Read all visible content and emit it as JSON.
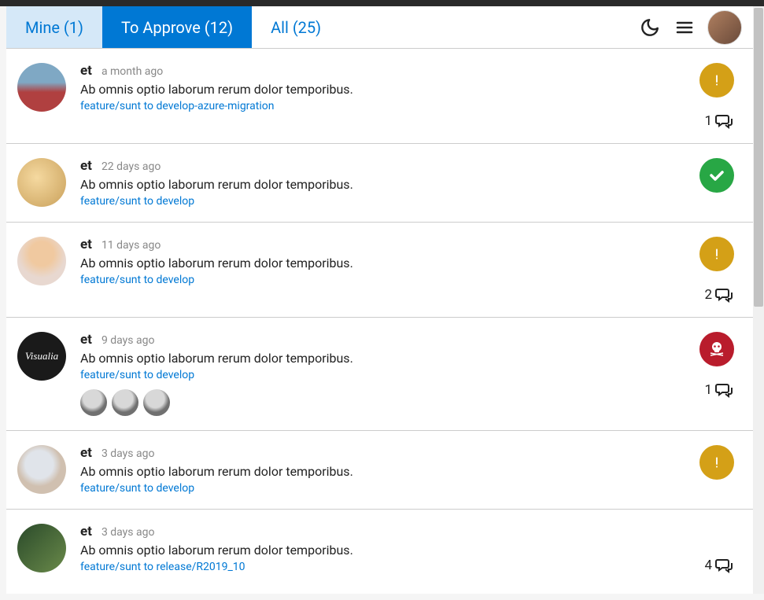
{
  "header": {
    "tabs": {
      "mine": "Mine (1)",
      "to_approve": "To Approve (12)",
      "all": "All (25)"
    }
  },
  "items": [
    {
      "title": "et",
      "time": "a month ago",
      "desc": "Ab omnis optio laborum rerum dolor temporibus.",
      "branch": "feature/sunt to develop-azure-migration",
      "status": "warn",
      "comments": "1",
      "avatar_label": ""
    },
    {
      "title": "et",
      "time": "22 days ago",
      "desc": "Ab omnis optio laborum rerum dolor temporibus.",
      "branch": "feature/sunt to develop",
      "status": "ok",
      "comments": "",
      "avatar_label": ""
    },
    {
      "title": "et",
      "time": "11 days ago",
      "desc": "Ab omnis optio laborum rerum dolor temporibus.",
      "branch": "feature/sunt to develop",
      "status": "warn",
      "comments": "2",
      "avatar_label": ""
    },
    {
      "title": "et",
      "time": "9 days ago",
      "desc": "Ab omnis optio laborum rerum dolor temporibus.",
      "branch": "feature/sunt to develop",
      "status": "danger",
      "comments": "1",
      "avatar_label": "Visualia",
      "sub_avatars": 3
    },
    {
      "title": "et",
      "time": "3 days ago",
      "desc": "Ab omnis optio laborum rerum dolor temporibus.",
      "branch": "feature/sunt to develop",
      "status": "warn",
      "comments": "",
      "avatar_label": ""
    },
    {
      "title": "et",
      "time": "3 days ago",
      "desc": "Ab omnis optio laborum rerum dolor temporibus.",
      "branch": "feature/sunt to release/R2019_10",
      "status": "",
      "comments": "4",
      "avatar_label": ""
    }
  ]
}
